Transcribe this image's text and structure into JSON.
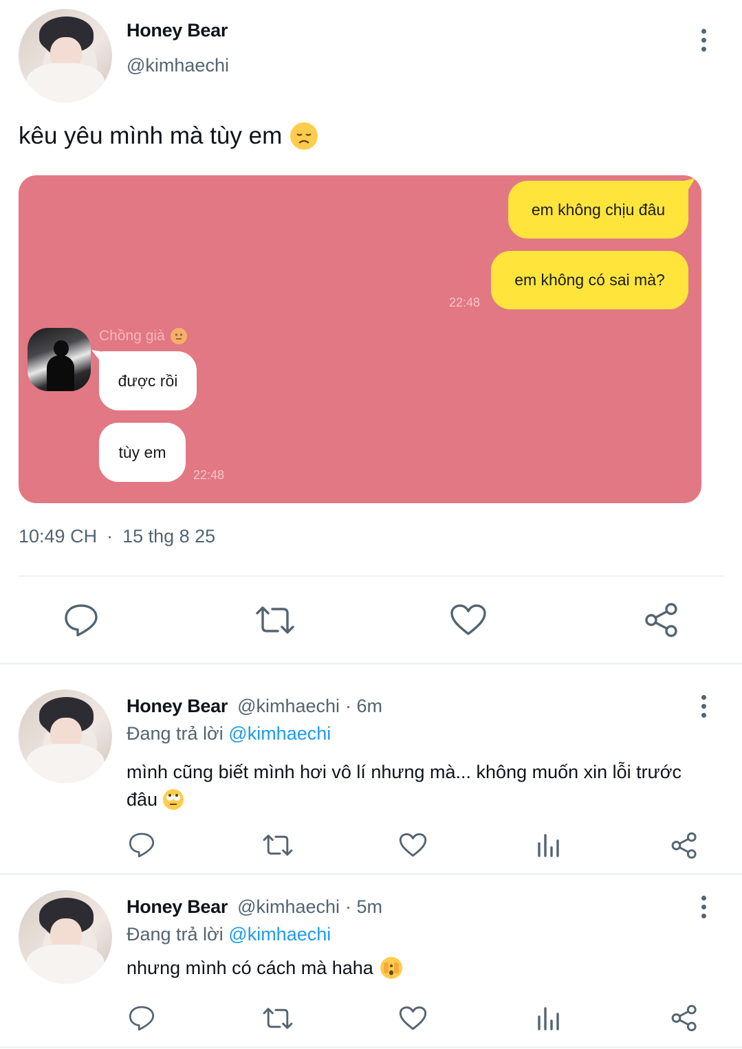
{
  "main_tweet": {
    "author_name": "Honey Bear",
    "author_handle": "@kimhaechi",
    "text": "kêu yêu mình mà tùy em",
    "text_emoji": "disappointed-face",
    "timestamp_time": "10:49 CH",
    "timestamp_sep": "·",
    "timestamp_date": "15 thg 8 25",
    "media": {
      "background_color": "#e27883",
      "sent_messages": [
        "em không chịu đâu",
        "em không có sai mà?"
      ],
      "sent_time": "22:48",
      "contact_name": "Chồng già",
      "contact_emoji": "neutral-face",
      "received_messages": [
        "được rồi",
        "tùy em"
      ],
      "received_time": "22:48"
    }
  },
  "replies": [
    {
      "author_name": "Honey Bear",
      "author_handle": "@kimhaechi",
      "time_ago": "· 6m",
      "replying_label": "Đang trả lời",
      "replying_to": "@kimhaechi",
      "text_line1": "mình cũng biết mình hơi vô lí nhưng mà... không muốn xin lỗi trước",
      "text_line2": "đâu",
      "emoji": "eye-roll-face"
    },
    {
      "author_name": "Honey Bear",
      "author_handle": "@kimhaechi",
      "time_ago": "· 5m",
      "replying_label": "Đang trả lời",
      "replying_to": "@kimhaechi",
      "text_line1": "nhưng mình có cách mà haha",
      "emoji": "face-with-peeking-eye"
    }
  ],
  "colors": {
    "accent": "#1d9bf0",
    "muted": "#536471",
    "bubble_sent": "#ffe53b",
    "bubble_received": "#ffffff"
  }
}
